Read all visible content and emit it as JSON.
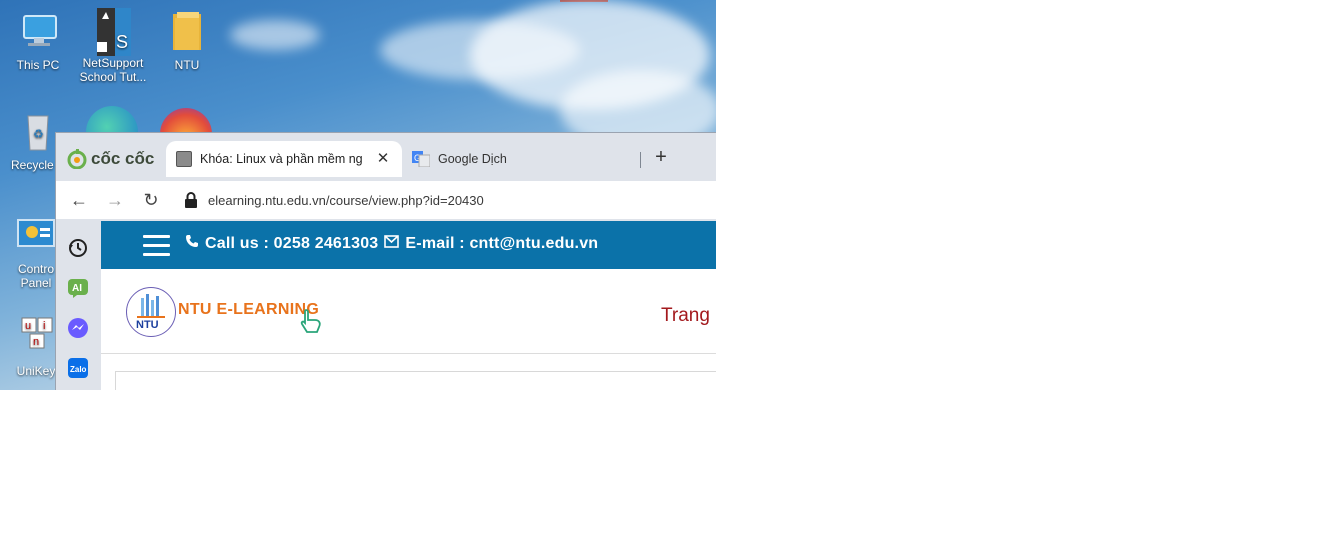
{
  "desktop": {
    "icons": [
      {
        "label": "This PC"
      },
      {
        "label": "NetSupport School Tut..."
      },
      {
        "label": "NTU"
      },
      {
        "label": "Recycle B"
      },
      {
        "label": "Contro Panel"
      },
      {
        "label": "UniKey"
      }
    ]
  },
  "browser": {
    "brand": "cốc cốc",
    "tabs": [
      {
        "title": "Khóa: Linux và phần mềm ng",
        "active": true
      },
      {
        "title": "Google Dịch",
        "active": false
      }
    ],
    "url": "elearning.ntu.edu.vn/course/view.php?id=20430",
    "sidebar_icons": [
      "history-icon",
      "ai-icon",
      "messenger-icon",
      "zalo-icon"
    ]
  },
  "site": {
    "phone_label": "Call us : 0258 2461303",
    "email_label": "E-mail : cntt@ntu.edu.vn",
    "logo_text": "NTU E-LEARNING",
    "logo_badge_text": "NTU",
    "nav_home": "Trang"
  },
  "colors": {
    "topbar": "#0b72a9",
    "logo_text": "#e8731c",
    "nav_home": "#a3191d"
  }
}
